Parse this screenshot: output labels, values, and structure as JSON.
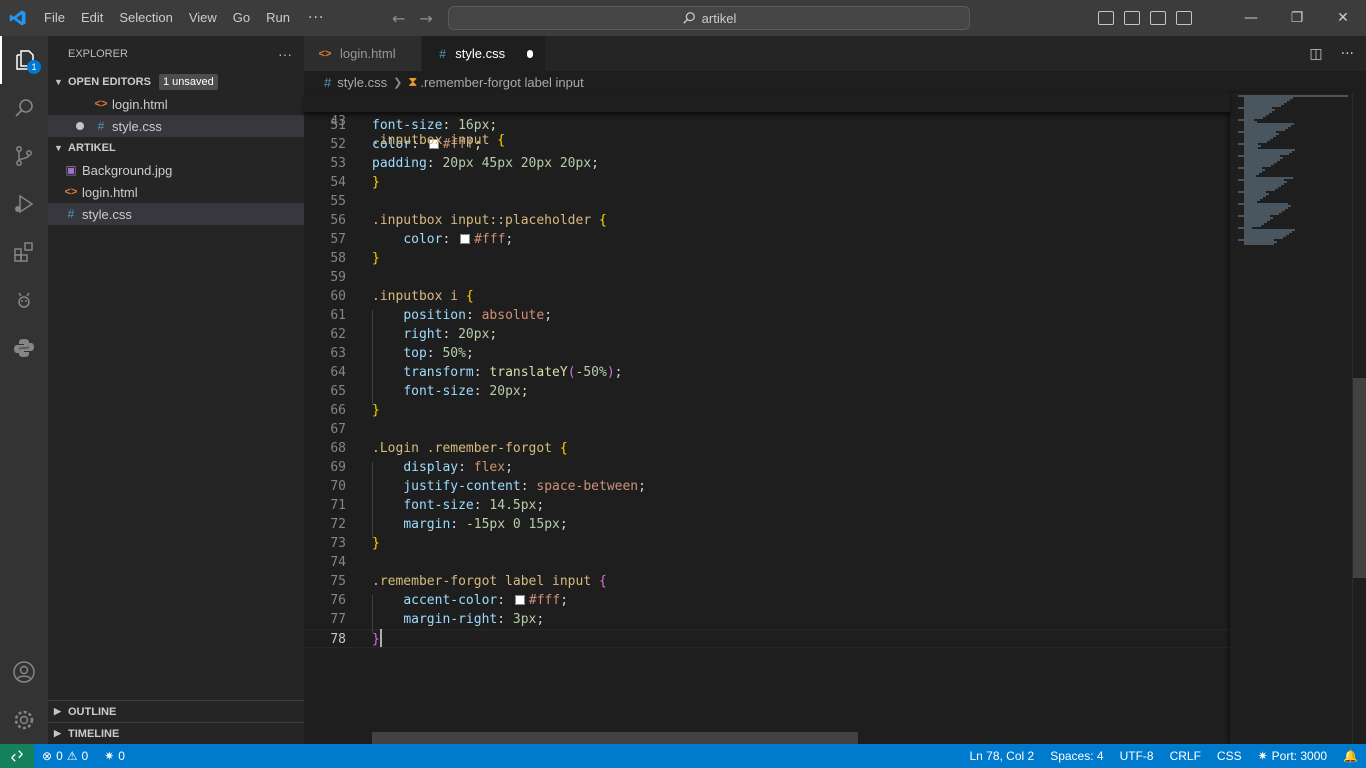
{
  "titlebar": {
    "menu": [
      "File",
      "Edit",
      "Selection",
      "View",
      "Go",
      "Run"
    ],
    "more": "···",
    "search": "artikel"
  },
  "activity": {
    "explorer_badge": "1"
  },
  "sidebar": {
    "title": "EXPLORER",
    "actions": "···",
    "open_editors": {
      "label": "OPEN EDITORS",
      "badge": "1 unsaved",
      "files": [
        "login.html",
        "style.css"
      ]
    },
    "project": {
      "label": "ARTIKEL",
      "files": [
        "Background.jpg",
        "login.html",
        "style.css"
      ]
    },
    "outline": "OUTLINE",
    "timeline": "TIMELINE"
  },
  "tabs": [
    {
      "label": "login.html"
    },
    {
      "label": "style.css"
    }
  ],
  "breadcrumb": {
    "file": "style.css",
    "symbol": ".remember-forgot label input"
  },
  "code": {
    "sticky": {
      "num": "43",
      "selector": ".inputbox input",
      "brace": "{"
    },
    "lines": [
      {
        "num": "51",
        "prop": "font-size",
        "val": "16px"
      },
      {
        "num": "52",
        "prop": "color",
        "val": "#fff"
      },
      {
        "num": "53",
        "prop": "padding",
        "val": "20px 45px 20px 20px"
      },
      {
        "num": "54",
        "text": "}"
      },
      {
        "num": "55",
        "text": ""
      },
      {
        "num": "56",
        "selector": ".inputbox input::placeholder",
        "brace": "{"
      },
      {
        "num": "57",
        "prop": "color",
        "val": "#fff"
      },
      {
        "num": "58",
        "text": "}"
      },
      {
        "num": "59",
        "text": ""
      },
      {
        "num": "60",
        "selector": ".inputbox i",
        "brace": "{"
      },
      {
        "num": "61",
        "prop": "position",
        "val": "absolute"
      },
      {
        "num": "62",
        "prop": "right",
        "val": "20px"
      },
      {
        "num": "63",
        "prop": "top",
        "val": "50%"
      },
      {
        "num": "64",
        "prop": "transform",
        "fn": "translateY",
        "arg": "-50%"
      },
      {
        "num": "65",
        "prop": "font-size",
        "val": "20px"
      },
      {
        "num": "66",
        "text": "}"
      },
      {
        "num": "67",
        "text": ""
      },
      {
        "num": "68",
        "selector": ".Login .remember-forgot",
        "brace": "{"
      },
      {
        "num": "69",
        "prop": "display",
        "val": "flex"
      },
      {
        "num": "70",
        "prop": "justify-content",
        "val": "space-between"
      },
      {
        "num": "71",
        "prop": "font-size",
        "val": "14.5px"
      },
      {
        "num": "72",
        "prop": "margin",
        "val": "-15px 0 15px"
      },
      {
        "num": "73",
        "text": "}"
      },
      {
        "num": "74",
        "text": ""
      },
      {
        "num": "75",
        "selector": ".remember-forgot label input",
        "brace": "{"
      },
      {
        "num": "76",
        "prop": "accent-color",
        "val": "#fff"
      },
      {
        "num": "77",
        "prop": "margin-right",
        "val": "3px"
      },
      {
        "num": "78",
        "text": "}"
      }
    ]
  },
  "status": {
    "errors": "0",
    "warnings": "0",
    "ports": "0",
    "position": "Ln 78, Col 2",
    "spaces": "Spaces: 4",
    "encoding": "UTF-8",
    "eol": "CRLF",
    "language": "CSS",
    "port": "Port: 3000"
  }
}
